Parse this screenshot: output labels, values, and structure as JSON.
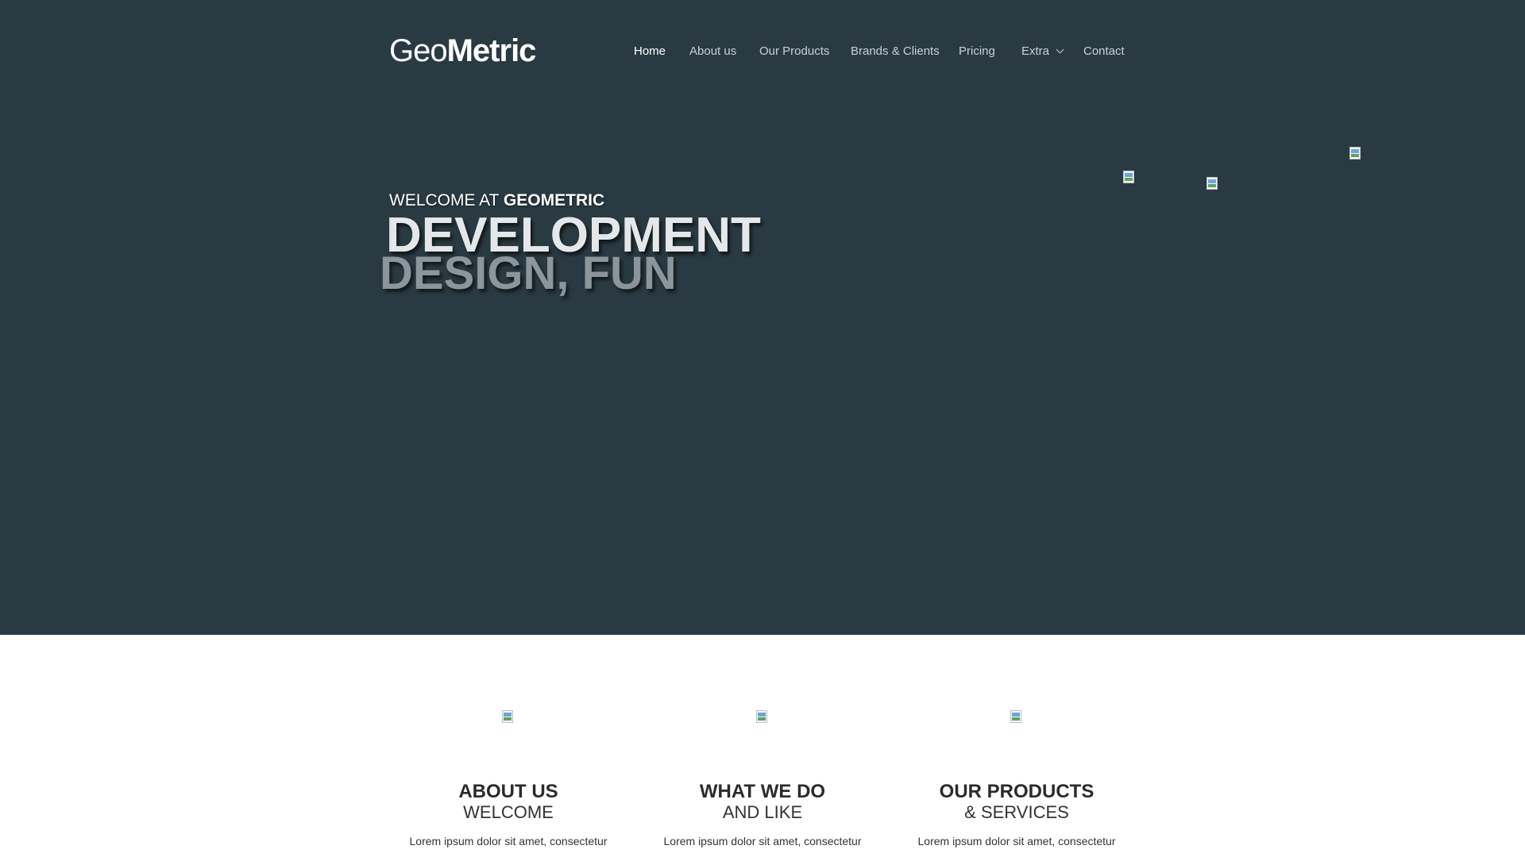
{
  "logo": {
    "thin": "Geo",
    "bold": "Metric"
  },
  "nav": {
    "items": [
      {
        "label": "Home",
        "active": true
      },
      {
        "label": "About us"
      },
      {
        "label": "Our Products"
      },
      {
        "label": "Brands & Clients"
      },
      {
        "label": "Pricing"
      },
      {
        "label": "Extra",
        "has_dropdown": true
      },
      {
        "label": "Contact"
      }
    ]
  },
  "hero": {
    "welcome_prefix": "WELCOME AT",
    "welcome_brand": "GEOMETRIC",
    "headline_1": "DEVELOPMENT",
    "headline_2": "DESIGN, FUN",
    "background_color": "#2a3a42"
  },
  "features": [
    {
      "title": "ABOUT US",
      "subtitle": "WELCOME",
      "text": "Lorem ipsum dolor sit amet, consectetur"
    },
    {
      "title": "WHAT WE DO",
      "subtitle": "AND LIKE",
      "text": "Lorem ipsum dolor sit amet, consectetur"
    },
    {
      "title": "OUR PRODUCTS",
      "subtitle": "& SERVICES",
      "text": "Lorem ipsum dolor sit amet, consectetur"
    }
  ]
}
